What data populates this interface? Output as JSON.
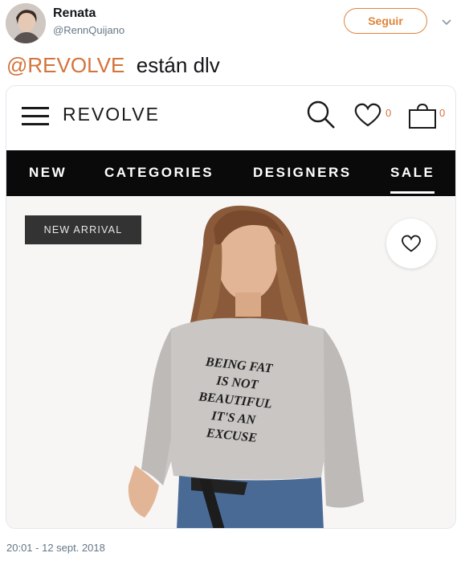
{
  "tweet": {
    "display_name": "Renata",
    "handle": "@RennQuijano",
    "follow_label": "Seguir",
    "mention": "@REVOLVE",
    "text": "  están dlv",
    "timestamp": "20:01 - 12 sept. 2018"
  },
  "revolve": {
    "brand": "REVOLVE",
    "wishlist_count": "0",
    "bag_count": "0",
    "nav": [
      "NEW",
      "CATEGORIES",
      "DESIGNERS",
      "SALE"
    ],
    "badge": "NEW ARRIVAL",
    "shirt_lines": [
      "BEING FAT",
      "IS NOT",
      "BEAUTIFUL",
      "IT'S AN",
      "EXCUSE"
    ]
  },
  "colors": {
    "accent": "#e0843a",
    "mention": "#d4733a",
    "navbar": "#0a0a0a",
    "badge": "#333333"
  }
}
